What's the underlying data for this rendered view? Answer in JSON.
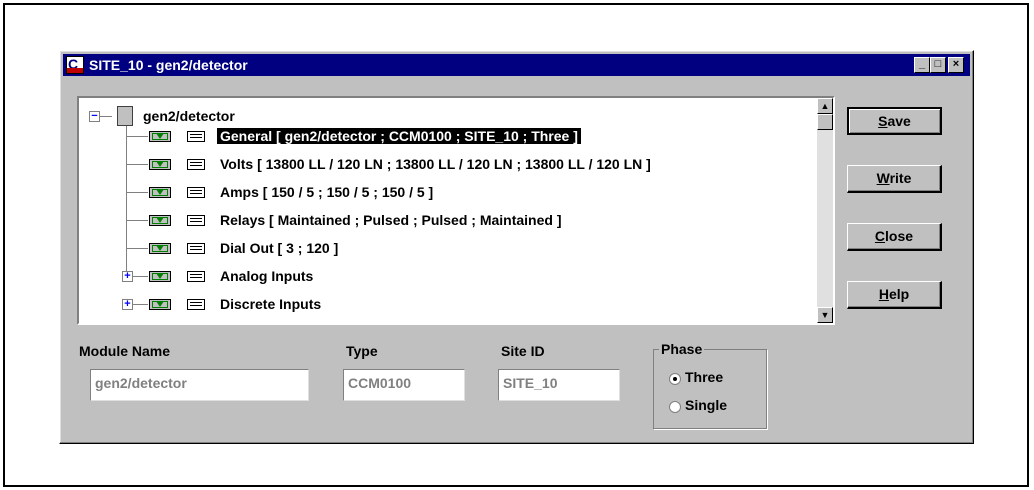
{
  "window": {
    "title": "SITE_10 - gen2/detector",
    "controls": {
      "minimize": "_",
      "maximize": "□",
      "close": "×"
    }
  },
  "tree": {
    "root": "gen2/detector",
    "items": [
      {
        "label": "General  [ gen2/detector ; CCM0100 ; SITE_10 ; Three ]",
        "selected": true
      },
      {
        "label": "Volts  [ 13800 LL / 120 LN ; 13800 LL / 120 LN ; 13800 LL / 120 LN ]"
      },
      {
        "label": "Amps  [ 150 / 5 ; 150 / 5 ; 150 / 5 ]"
      },
      {
        "label": "Relays  [ Maintained ; Pulsed ; Pulsed ; Maintained ]"
      },
      {
        "label": "Dial Out  [ 3 ; 120 ]"
      },
      {
        "label": "Analog Inputs",
        "expandable": true
      },
      {
        "label": "Discrete Inputs",
        "expandable": true
      }
    ]
  },
  "buttons": {
    "save": {
      "mnemonic": "S",
      "rest": "ave"
    },
    "write": {
      "mnemonic": "W",
      "rest": "rite"
    },
    "close": {
      "mnemonic": "C",
      "rest": "lose"
    },
    "help": {
      "mnemonic": "H",
      "rest": "elp"
    }
  },
  "fields": {
    "module_name": {
      "label": "Module Name",
      "value": "gen2/detector"
    },
    "type": {
      "label": "Type",
      "value": "CCM0100"
    },
    "site_id": {
      "label": "Site ID",
      "value": "SITE_10"
    }
  },
  "phase": {
    "title": "Phase",
    "options": [
      "Three",
      "Single"
    ],
    "selected": "Three"
  }
}
